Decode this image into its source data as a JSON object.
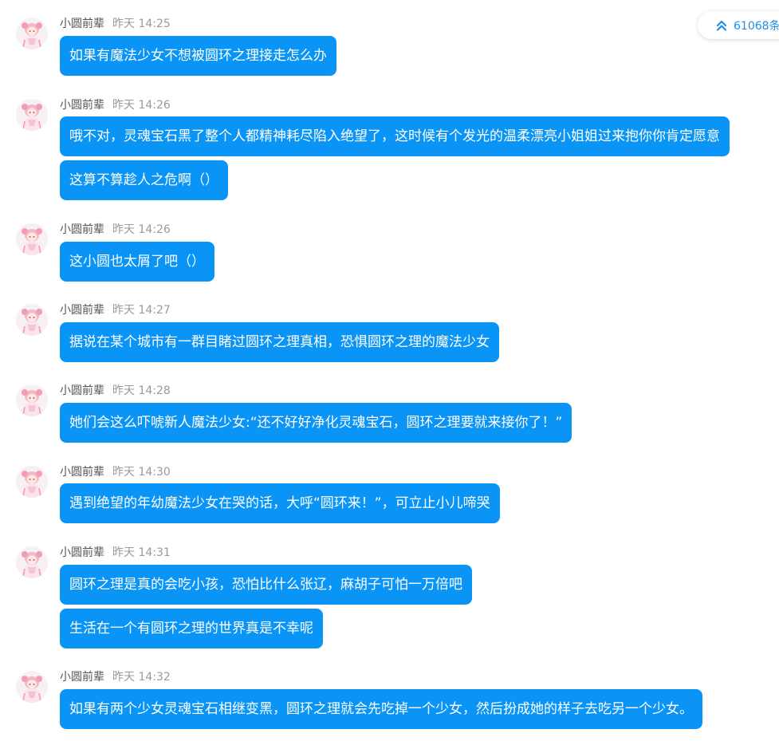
{
  "jump": {
    "label": "61068条",
    "icon": "double-chevron-up-icon"
  },
  "colors": {
    "bubble": "#0a95f6",
    "bubble_text": "#ffffff",
    "name": "#555555",
    "time": "#9a9a9a",
    "jump_text": "#1e8fe6"
  },
  "messages": [
    {
      "sender": "小圆前辈",
      "time": "昨天 14:25",
      "bubbles": [
        "如果有魔法少女不想被圆环之理接走怎么办"
      ]
    },
    {
      "sender": "小圆前辈",
      "time": "昨天 14:26",
      "bubbles": [
        "哦不对，灵魂宝石黑了整个人都精神耗尽陷入绝望了，这时候有个发光的温柔漂亮小姐姐过来抱你你肯定愿意",
        "这算不算趁人之危啊（）"
      ]
    },
    {
      "sender": "小圆前辈",
      "time": "昨天 14:26",
      "bubbles": [
        "这小圆也太屑了吧（）"
      ]
    },
    {
      "sender": "小圆前辈",
      "time": "昨天 14:27",
      "bubbles": [
        "据说在某个城市有一群目睹过圆环之理真相，恐惧圆环之理的魔法少女"
      ]
    },
    {
      "sender": "小圆前辈",
      "time": "昨天 14:28",
      "bubbles": [
        "她们会这么吓唬新人魔法少女:“还不好好净化灵魂宝石，圆环之理要就来接你了！”"
      ]
    },
    {
      "sender": "小圆前辈",
      "time": "昨天 14:30",
      "bubbles": [
        "遇到绝望的年幼魔法少女在哭的话，大呼“圆环来！”，可立止小儿啼哭"
      ]
    },
    {
      "sender": "小圆前辈",
      "time": "昨天 14:31",
      "bubbles": [
        "圆环之理是真的会吃小孩，恐怕比什么张辽，麻胡子可怕一万倍吧",
        "生活在一个有圆环之理的世界真是不幸呢"
      ]
    },
    {
      "sender": "小圆前辈",
      "time": "昨天 14:32",
      "bubbles": [
        "如果有两个少女灵魂宝石相继变黑，圆环之理就会先吃掉一个少女，然后扮成她的样子去吃另一个少女。"
      ]
    }
  ]
}
